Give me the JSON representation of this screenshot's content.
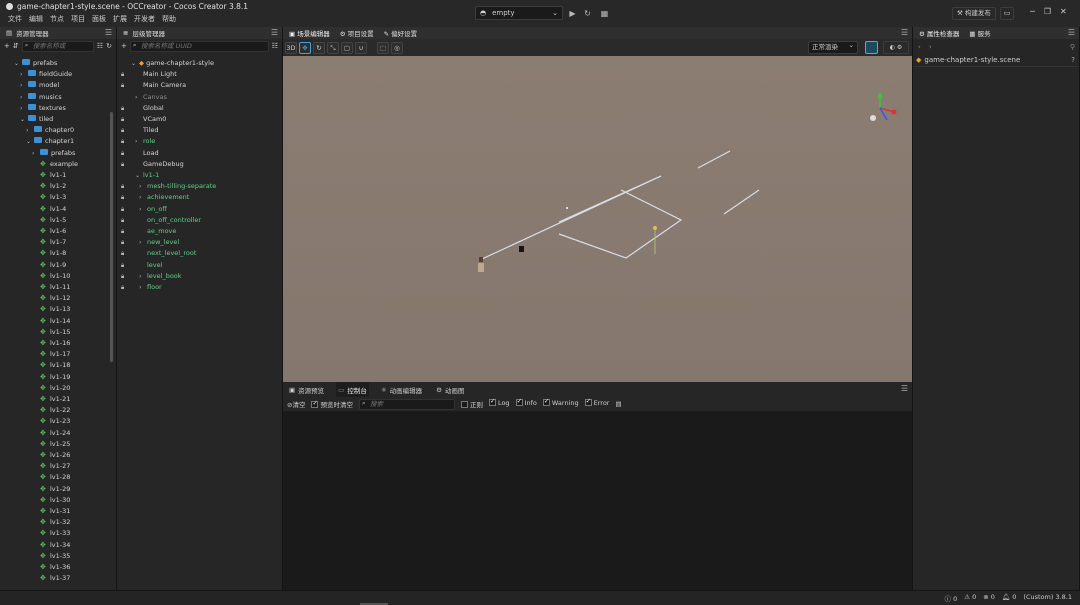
{
  "window": {
    "title": "game-chapter1-style.scene - OCCreator - Cocos Creator 3.8.1",
    "menu": [
      "文件",
      "编辑",
      "节点",
      "项目",
      "面板",
      "扩展",
      "开发者",
      "帮助"
    ],
    "platform": "empty",
    "build_label": "构建发布"
  },
  "assets": {
    "tab": "资源管理器",
    "search_placeholder": "搜索名称或",
    "items": [
      {
        "label": "prefabs",
        "indent": 1,
        "arrow": "⌄",
        "type": "folder"
      },
      {
        "label": "fieldGuide",
        "indent": 2,
        "arrow": "›",
        "type": "folder"
      },
      {
        "label": "model",
        "indent": 2,
        "arrow": "›",
        "type": "folder"
      },
      {
        "label": "musics",
        "indent": 2,
        "arrow": "›",
        "type": "folder"
      },
      {
        "label": "textures",
        "indent": 2,
        "arrow": "›",
        "type": "folder"
      },
      {
        "label": "tiled",
        "indent": 2,
        "arrow": "⌄",
        "type": "folder"
      },
      {
        "label": "chapter0",
        "indent": 3,
        "arrow": "›",
        "type": "folder"
      },
      {
        "label": "chapter1",
        "indent": 3,
        "arrow": "⌄",
        "type": "folder"
      },
      {
        "label": "prefabs",
        "indent": 4,
        "arrow": "›",
        "type": "folder"
      },
      {
        "label": "example",
        "indent": 4,
        "arrow": "",
        "type": "scene"
      },
      {
        "label": "lv1-1",
        "indent": 4,
        "arrow": "",
        "type": "scene"
      },
      {
        "label": "lv1-2",
        "indent": 4,
        "arrow": "",
        "type": "scene"
      },
      {
        "label": "lv1-3",
        "indent": 4,
        "arrow": "",
        "type": "scene"
      },
      {
        "label": "lv1-4",
        "indent": 4,
        "arrow": "",
        "type": "scene"
      },
      {
        "label": "lv1-5",
        "indent": 4,
        "arrow": "",
        "type": "scene"
      },
      {
        "label": "lv1-6",
        "indent": 4,
        "arrow": "",
        "type": "scene"
      },
      {
        "label": "lv1-7",
        "indent": 4,
        "arrow": "",
        "type": "scene"
      },
      {
        "label": "lv1-8",
        "indent": 4,
        "arrow": "",
        "type": "scene"
      },
      {
        "label": "lv1-9",
        "indent": 4,
        "arrow": "",
        "type": "scene"
      },
      {
        "label": "lv1-10",
        "indent": 4,
        "arrow": "",
        "type": "scene"
      },
      {
        "label": "lv1-11",
        "indent": 4,
        "arrow": "",
        "type": "scene"
      },
      {
        "label": "lv1-12",
        "indent": 4,
        "arrow": "",
        "type": "scene"
      },
      {
        "label": "lv1-13",
        "indent": 4,
        "arrow": "",
        "type": "scene"
      },
      {
        "label": "lv1-14",
        "indent": 4,
        "arrow": "",
        "type": "scene"
      },
      {
        "label": "lv1-15",
        "indent": 4,
        "arrow": "",
        "type": "scene"
      },
      {
        "label": "lv1-16",
        "indent": 4,
        "arrow": "",
        "type": "scene"
      },
      {
        "label": "lv1-17",
        "indent": 4,
        "arrow": "",
        "type": "scene"
      },
      {
        "label": "lv1-18",
        "indent": 4,
        "arrow": "",
        "type": "scene"
      },
      {
        "label": "lv1-19",
        "indent": 4,
        "arrow": "",
        "type": "scene"
      },
      {
        "label": "lv1-20",
        "indent": 4,
        "arrow": "",
        "type": "scene"
      },
      {
        "label": "lv1-21",
        "indent": 4,
        "arrow": "",
        "type": "scene"
      },
      {
        "label": "lv1-22",
        "indent": 4,
        "arrow": "",
        "type": "scene"
      },
      {
        "label": "lv1-23",
        "indent": 4,
        "arrow": "",
        "type": "scene"
      },
      {
        "label": "lv1-24",
        "indent": 4,
        "arrow": "",
        "type": "scene"
      },
      {
        "label": "lv1-25",
        "indent": 4,
        "arrow": "",
        "type": "scene"
      },
      {
        "label": "lv1-26",
        "indent": 4,
        "arrow": "",
        "type": "scene"
      },
      {
        "label": "lv1-27",
        "indent": 4,
        "arrow": "",
        "type": "scene"
      },
      {
        "label": "lv1-28",
        "indent": 4,
        "arrow": "",
        "type": "scene"
      },
      {
        "label": "lv1-29",
        "indent": 4,
        "arrow": "",
        "type": "scene"
      },
      {
        "label": "lv1-30",
        "indent": 4,
        "arrow": "",
        "type": "scene"
      },
      {
        "label": "lv1-31",
        "indent": 4,
        "arrow": "",
        "type": "scene"
      },
      {
        "label": "lv1-32",
        "indent": 4,
        "arrow": "",
        "type": "scene"
      },
      {
        "label": "lv1-33",
        "indent": 4,
        "arrow": "",
        "type": "scene"
      },
      {
        "label": "lv1-34",
        "indent": 4,
        "arrow": "",
        "type": "scene"
      },
      {
        "label": "lv1-35",
        "indent": 4,
        "arrow": "",
        "type": "scene"
      },
      {
        "label": "lv1-36",
        "indent": 4,
        "arrow": "",
        "type": "scene"
      },
      {
        "label": "lv1-37",
        "indent": 4,
        "arrow": "",
        "type": "scene"
      }
    ]
  },
  "hierarchy": {
    "tab": "层级管理器",
    "search_placeholder": "搜索名称或 UUID",
    "items": [
      {
        "label": "game-chapter1-style",
        "indent": 0,
        "arrow": "⌄",
        "lock": false,
        "color": "normal"
      },
      {
        "label": "Main Light",
        "indent": 1,
        "arrow": "",
        "lock": true,
        "color": "normal"
      },
      {
        "label": "Main Camera",
        "indent": 1,
        "arrow": "",
        "lock": true,
        "color": "normal"
      },
      {
        "label": "Canvas",
        "indent": 1,
        "arrow": "›",
        "lock": false,
        "color": "gray"
      },
      {
        "label": "Global",
        "indent": 1,
        "arrow": "",
        "lock": true,
        "color": "normal"
      },
      {
        "label": "VCam0",
        "indent": 1,
        "arrow": "",
        "lock": true,
        "color": "normal"
      },
      {
        "label": "Tiled",
        "indent": 1,
        "arrow": "",
        "lock": true,
        "color": "normal"
      },
      {
        "label": "role",
        "indent": 1,
        "arrow": "›",
        "lock": true,
        "color": "green"
      },
      {
        "label": "Load",
        "indent": 1,
        "arrow": "",
        "lock": true,
        "color": "normal"
      },
      {
        "label": "GameDebug",
        "indent": 1,
        "arrow": "",
        "lock": true,
        "color": "normal"
      },
      {
        "label": "lv1-1",
        "indent": 1,
        "arrow": "⌄",
        "lock": false,
        "color": "green"
      },
      {
        "label": "mesh-tilling-separate",
        "indent": 2,
        "arrow": "›",
        "lock": true,
        "color": "green"
      },
      {
        "label": "achievement",
        "indent": 2,
        "arrow": "›",
        "lock": true,
        "color": "green"
      },
      {
        "label": "on_off",
        "indent": 2,
        "arrow": "›",
        "lock": true,
        "color": "green"
      },
      {
        "label": "on_off_controller",
        "indent": 2,
        "arrow": "",
        "lock": true,
        "color": "green"
      },
      {
        "label": "ae_move",
        "indent": 2,
        "arrow": "",
        "lock": true,
        "color": "green"
      },
      {
        "label": "new_level",
        "indent": 2,
        "arrow": "›",
        "lock": true,
        "color": "green"
      },
      {
        "label": "next_level_root",
        "indent": 2,
        "arrow": "",
        "lock": true,
        "color": "green"
      },
      {
        "label": "level",
        "indent": 2,
        "arrow": "",
        "lock": true,
        "color": "green"
      },
      {
        "label": "level_book",
        "indent": 2,
        "arrow": "›",
        "lock": true,
        "color": "green"
      },
      {
        "label": "floor",
        "indent": 2,
        "arrow": "›",
        "lock": true,
        "color": "green"
      }
    ]
  },
  "scene": {
    "tabs": [
      "场景编辑器",
      "项目设置",
      "偏好设置"
    ],
    "mode_3d": "3D",
    "render_mode": "正常渲染"
  },
  "console": {
    "tabs": [
      "资源预览",
      "控制台",
      "动画编辑器",
      "动画图"
    ],
    "active_tab": 1,
    "clear_label": "清空",
    "clear_on_play_label": "预览时清空",
    "search_placeholder": "搜索",
    "filters": [
      {
        "label": "正则",
        "checked": false
      },
      {
        "label": "Log",
        "checked": true
      },
      {
        "label": "Info",
        "checked": true
      },
      {
        "label": "Warning",
        "checked": true
      },
      {
        "label": "Error",
        "checked": true
      }
    ]
  },
  "inspector": {
    "tabs": [
      "属性检查器",
      "服务"
    ],
    "asset_name": "game-chapter1-style.scene"
  },
  "status": {
    "info_count": "0",
    "warn_count": "0",
    "error_count": "0",
    "notif_count": "0",
    "version": "(Custom) 3.8.1"
  },
  "colors": {
    "accent": "#4a9fd8",
    "green_node": "#5fd08a",
    "folder": "#3d8fd6",
    "viewport_bg": "#8a7a70"
  }
}
